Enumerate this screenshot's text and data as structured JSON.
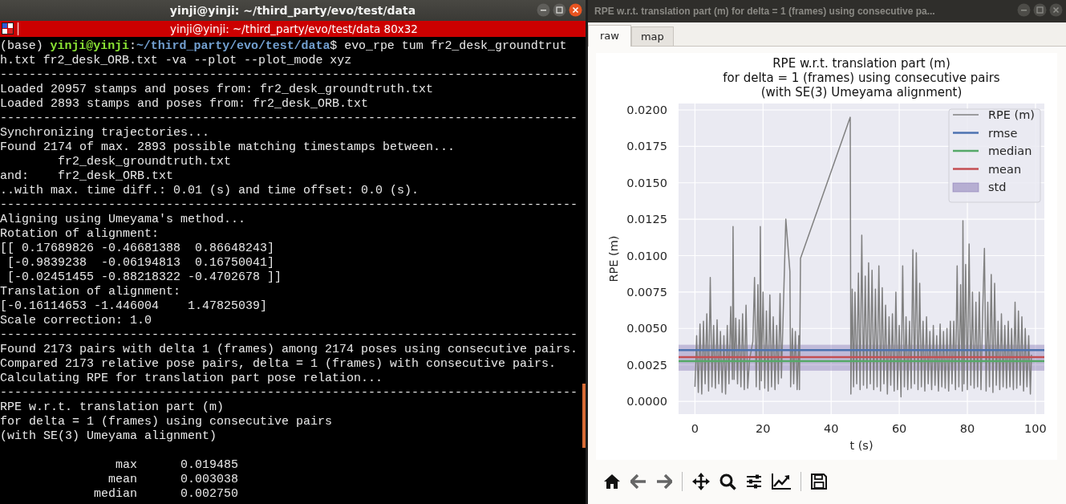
{
  "terminal": {
    "title": "yinji@yinji: ~/third_party/evo/test/data",
    "tab_title": "yinji@yinji: ~/third_party/evo/test/data 80x32",
    "lines": [
      {
        "kind": "prompt",
        "env": "(base) ",
        "user": "yinji@yinji",
        "sep": ":",
        "path": "~/third_party/evo/test/data",
        "command": "$ evo_rpe tum fr2_desk_groundtruth.txt fr2_desk_ORB.txt -va --plot --plot_mode xyz"
      },
      {
        "kind": "text",
        "text": "--------------------------------------------------------------------------------"
      },
      {
        "kind": "text",
        "text": "Loaded 20957 stamps and poses from: fr2_desk_groundtruth.txt"
      },
      {
        "kind": "text",
        "text": "Loaded 2893 stamps and poses from: fr2_desk_ORB.txt"
      },
      {
        "kind": "text",
        "text": "--------------------------------------------------------------------------------"
      },
      {
        "kind": "text",
        "text": "Synchronizing trajectories..."
      },
      {
        "kind": "text",
        "text": "Found 2174 of max. 2893 possible matching timestamps between..."
      },
      {
        "kind": "text",
        "text": "        fr2_desk_groundtruth.txt"
      },
      {
        "kind": "text",
        "text": "and:    fr2_desk_ORB.txt"
      },
      {
        "kind": "text",
        "text": "..with max. time diff.: 0.01 (s) and time offset: 0.0 (s)."
      },
      {
        "kind": "text",
        "text": "--------------------------------------------------------------------------------"
      },
      {
        "kind": "text",
        "text": "Aligning using Umeyama's method..."
      },
      {
        "kind": "text",
        "text": "Rotation of alignment:"
      },
      {
        "kind": "text",
        "text": "[[ 0.17689826 -0.46681388  0.86648243]"
      },
      {
        "kind": "text",
        "text": " [-0.9839238  -0.06194813  0.16750041]"
      },
      {
        "kind": "text",
        "text": " [-0.02451455 -0.88218322 -0.4702678 ]]"
      },
      {
        "kind": "text",
        "text": "Translation of alignment:"
      },
      {
        "kind": "text",
        "text": "[-0.16114653 -1.446004    1.47825039]"
      },
      {
        "kind": "text",
        "text": "Scale correction: 1.0"
      },
      {
        "kind": "text",
        "text": "--------------------------------------------------------------------------------"
      },
      {
        "kind": "text",
        "text": "Found 2173 pairs with delta 1 (frames) among 2174 poses using consecutive pairs."
      },
      {
        "kind": "text",
        "text": "Compared 2173 relative pose pairs, delta = 1 (frames) with consecutive pairs."
      },
      {
        "kind": "text",
        "text": "Calculating RPE for translation part pose relation..."
      },
      {
        "kind": "text",
        "text": "--------------------------------------------------------------------------------"
      },
      {
        "kind": "text",
        "text": "RPE w.r.t. translation part (m)"
      },
      {
        "kind": "text",
        "text": "for delta = 1 (frames) using consecutive pairs"
      },
      {
        "kind": "text",
        "text": "(with SE(3) Umeyama alignment)"
      },
      {
        "kind": "blank"
      },
      {
        "kind": "stat",
        "label": "max",
        "value": "0.019485"
      },
      {
        "kind": "stat",
        "label": "mean",
        "value": "0.003038"
      },
      {
        "kind": "stat",
        "label": "median",
        "value": "0.002750"
      }
    ]
  },
  "plot_window": {
    "title": "RPE w.r.t. translation part (m) for delta = 1 (frames) using consecutive pa...",
    "tabs": [
      {
        "label": "raw",
        "selected": true
      },
      {
        "label": "map",
        "selected": false
      }
    ],
    "figure": {
      "chart_data": {
        "type": "line",
        "title": "RPE w.r.t. translation part (m)\nfor delta = 1 (frames) using consecutive pairs\n(with SE(3) Umeyama alignment)",
        "xlabel": "t (s)",
        "ylabel": "RPE (m)",
        "xlim": [
          -4.8,
          102.6
        ],
        "ylim": [
          -0.00088,
          0.02044
        ],
        "xticks": [
          0,
          20,
          40,
          60,
          80,
          100
        ],
        "yticks": [
          {
            "value": 0,
            "label": "0.0000"
          },
          {
            "value": 0.0025,
            "label": "0.0025"
          },
          {
            "value": 0.005,
            "label": "0.0050"
          },
          {
            "value": 0.0075,
            "label": "0.0075"
          },
          {
            "value": 0.01,
            "label": "0.0100"
          },
          {
            "value": 0.0125,
            "label": "0.0125"
          },
          {
            "value": 0.015,
            "label": "0.0150"
          },
          {
            "value": 0.0175,
            "label": "0.0175"
          },
          {
            "value": 0.02,
            "label": "0.0200"
          }
        ],
        "x": [
          0,
          0.5,
          1,
          1.5,
          2,
          2.5,
          3,
          3.5,
          4,
          4.5,
          5,
          5.5,
          6,
          6.5,
          7,
          7.5,
          8,
          8.5,
          9,
          9.5,
          10,
          10.5,
          11,
          11.2,
          11.5,
          12,
          12.5,
          13,
          13.5,
          14,
          14.5,
          15,
          15.5,
          16,
          17,
          17.5,
          18,
          18.5,
          19,
          19.2,
          19.5,
          20,
          20.5,
          21,
          21.5,
          22,
          22.5,
          23,
          23.5,
          24,
          24.5,
          25,
          25.4,
          26.7,
          27.9,
          28.1,
          28.6,
          29,
          29.5,
          30,
          30.5,
          30.7,
          31,
          45.6,
          45.8,
          46.2,
          46.6,
          47,
          47.5,
          48,
          48.5,
          49,
          49.5,
          50,
          50.5,
          51,
          51.5,
          52,
          52.5,
          53,
          53.5,
          54,
          54.5,
          55,
          55.5,
          56,
          56.5,
          57,
          57.5,
          58,
          58.5,
          59,
          59.5,
          60,
          60.5,
          61,
          61.5,
          62,
          62.5,
          63,
          63.5,
          64,
          64.5,
          65,
          65.5,
          66,
          66.5,
          67,
          67.5,
          68,
          68.5,
          69,
          69.5,
          70,
          70.5,
          71,
          71.5,
          72,
          72.5,
          73,
          73.5,
          74,
          74.5,
          75,
          75.5,
          76,
          76.5,
          77,
          77.5,
          78,
          78.5,
          78.7,
          79,
          79.5,
          80,
          80.5,
          81,
          81.5,
          82,
          82.5,
          83,
          83.5,
          84,
          84.5,
          85,
          85.5,
          86,
          86.5,
          87,
          87.5,
          88,
          88.5,
          89,
          89.5,
          90,
          90.5,
          91,
          91.5,
          92,
          92.5,
          93,
          93.5,
          94,
          94.5,
          95,
          95.5,
          96,
          96.5,
          97,
          97.5,
          98,
          98.5,
          98.8
        ],
        "series": [
          {
            "name": "RPE (m)",
            "color": "#808080",
            "values": [
              0.001,
              0.0045,
              0.0006,
              0.0053,
              0.0005,
              0.0055,
              0.0012,
              0.006,
              0.0007,
              0.0085,
              0.001,
              0.0052,
              0.0009,
              0.0056,
              0.0012,
              0.0048,
              0.0006,
              0.0045,
              0.0005,
              0.0052,
              0.0012,
              0.0065,
              0.0015,
              0.012,
              0.0015,
              0.0057,
              0.0012,
              0.0056,
              0.001,
              0.006,
              0.0008,
              0.0066,
              0.0009,
              0.0028,
              0.0041,
              0.0085,
              0.001,
              0.008,
              0.0008,
              0.012,
              0.0014,
              0.0075,
              0.0009,
              0.0062,
              0.0007,
              0.0073,
              0.001,
              0.0058,
              0.0008,
              0.0052,
              0.0012,
              0.0074,
              0.0016,
              0.0125,
              0.0089,
              0.001,
              0.005,
              0.0012,
              0.0048,
              0.0008,
              0.0045,
              0.0008,
              0.0098,
              0.0195,
              0.0005,
              0.0077,
              0.001,
              0.0075,
              0.0012,
              0.0088,
              0.0008,
              0.0114,
              0.0011,
              0.0086,
              0.0009,
              0.0095,
              0.0012,
              0.009,
              0.0008,
              0.0077,
              0.001,
              0.0093,
              0.0007,
              0.0078,
              0.0012,
              0.0066,
              0.0005,
              0.0058,
              0.0011,
              0.006,
              0.0007,
              0.0075,
              0.0008,
              0.0052,
              0.0003,
              0.0093,
              0.001,
              0.0058,
              0.0008,
              0.0055,
              0.0009,
              0.0104,
              0.0012,
              0.0102,
              0.0008,
              0.0081,
              0.001,
              0.0055,
              0.0007,
              0.0058,
              0.0012,
              0.0048,
              0.0008,
              0.0052,
              0.0011,
              0.0045,
              0.0007,
              0.0053,
              0.001,
              0.0048,
              0.0009,
              0.005,
              0.0007,
              0.0055,
              0.0012,
              0.0055,
              0.0008,
              0.0093,
              0.001,
              0.008,
              0.0007,
              0.0124,
              0.0012,
              0.0094,
              0.0008,
              0.0108,
              0.0011,
              0.0075,
              0.0009,
              0.0068,
              0.001,
              0.0075,
              0.0008,
              0.0063,
              0.0105,
              0.0007,
              0.0068,
              0.001,
              0.0087,
              0.0006,
              0.0081,
              0.0011,
              0.0055,
              0.0008,
              0.006,
              0.001,
              0.0052,
              0.0009,
              0.0055,
              0.001,
              0.005,
              0.0008,
              0.0068,
              0.0009,
              0.0062,
              0.0011,
              0.0058,
              0.0007,
              0.005,
              0.001,
              0.0045,
              0.0005,
              0.0032
            ]
          }
        ],
        "grid": true,
        "legend": "upper right",
        "ref_lines": [
          {
            "axis": "y",
            "label": "rmse",
            "value": 0.00352,
            "color": "#4c72b0"
          },
          {
            "axis": "y",
            "label": "median",
            "value": 0.00275,
            "color": "#55a868"
          },
          {
            "axis": "y",
            "label": "mean",
            "value": 0.003038,
            "color": "#c44e52"
          }
        ],
        "bands": [
          {
            "axis": "y",
            "label": "std",
            "from": 0.0021,
            "to": 0.00388,
            "color": "#8172b2"
          }
        ]
      }
    }
  }
}
